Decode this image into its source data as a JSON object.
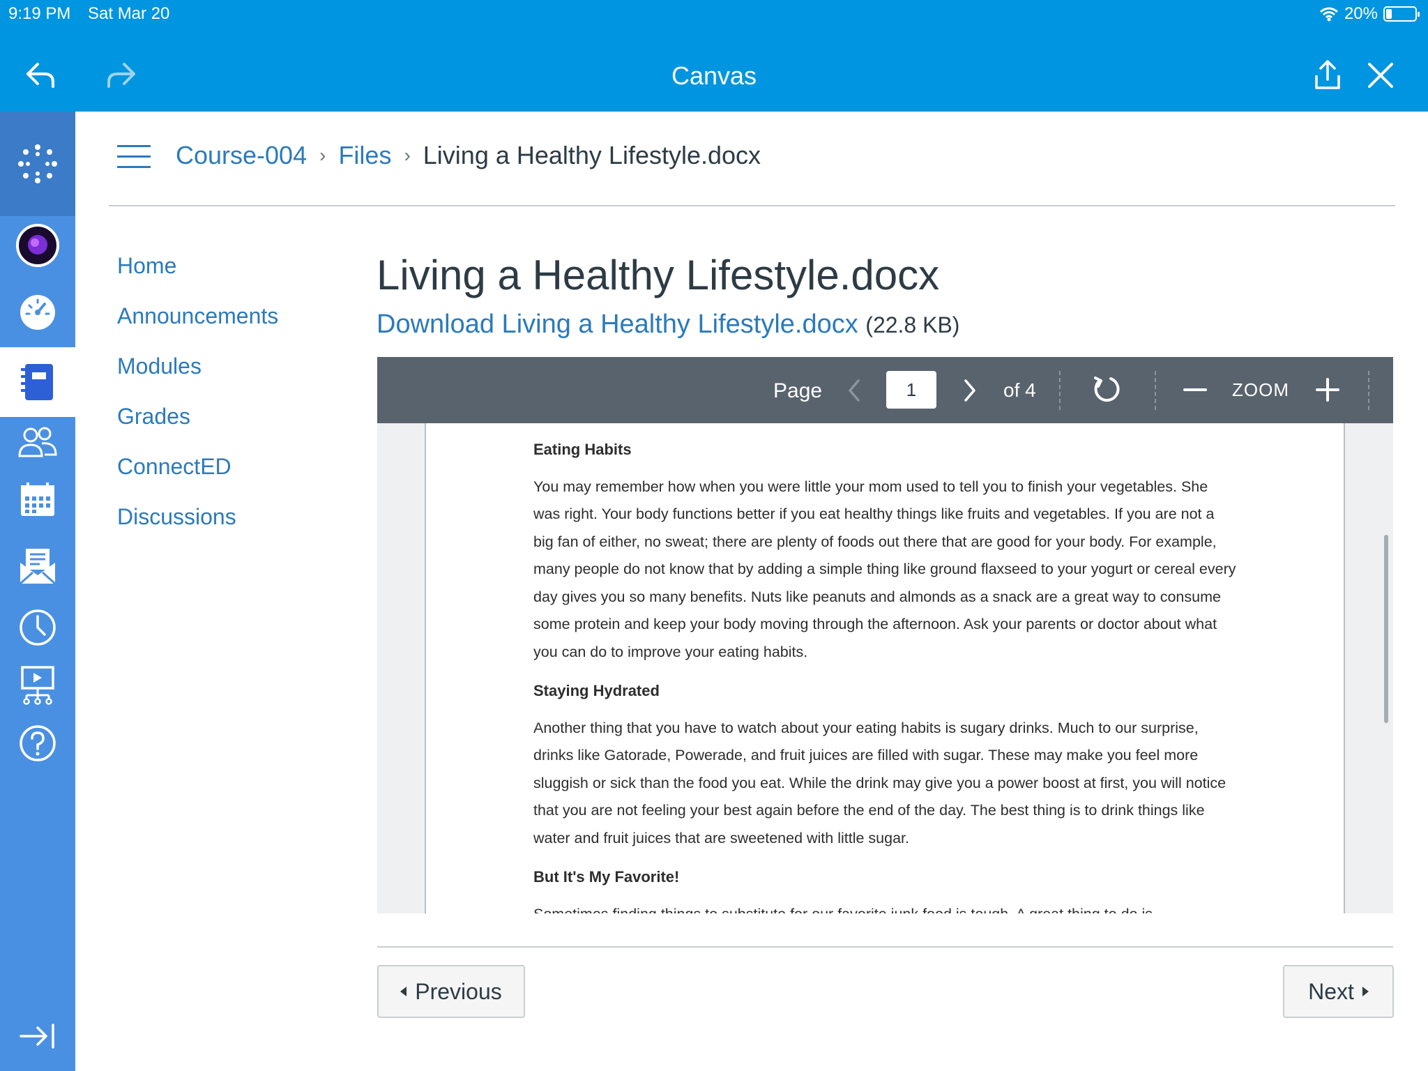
{
  "status_bar": {
    "time": "9:19 PM",
    "date": "Sat Mar 20",
    "battery_percent": "20%",
    "battery_level": 0.2
  },
  "top_nav": {
    "title": "Canvas",
    "icons": [
      "back-arrow-icon",
      "forward-arrow-icon",
      "share-icon",
      "close-icon"
    ]
  },
  "global_nav": {
    "icons": [
      "canvas-logo-icon",
      "account-avatar",
      "dashboard-icon",
      "courses-icon",
      "groups-icon",
      "calendar-icon",
      "inbox-icon",
      "history-icon",
      "studio-icon",
      "help-icon",
      "collapse-nav-icon"
    ]
  },
  "breadcrumb": {
    "course": "Course-004",
    "section": "Files",
    "current": "Living a Healthy Lifestyle.docx"
  },
  "course_nav": {
    "items": [
      "Home",
      "Announcements",
      "Modules",
      "Grades",
      "ConnectED",
      "Discussions"
    ]
  },
  "file": {
    "title": "Living a Healthy Lifestyle.docx",
    "download_label": "Download Living a Healthy Lifestyle.docx",
    "size": "(22.8 KB)"
  },
  "viewer": {
    "page_label": "Page",
    "page_value": "1",
    "page_total": "of 4",
    "zoom_label": "ZOOM",
    "icons": [
      "chevron-left-icon",
      "chevron-right-icon",
      "rotate-icon",
      "zoom-out-icon",
      "zoom-in-icon"
    ]
  },
  "document": {
    "sections": [
      {
        "heading": "Eating Habits",
        "body": "You may remember how when you were little your mom used to tell you to finish your vegetables. She was right. Your body functions better if you eat healthy things like fruits and vegetables. If you are not a big fan of either, no sweat; there are plenty of foods out there that are good for your body. For example, many people do not know that by adding a simple thing like ground flaxseed to your yogurt or cereal every day gives you so many benefits. Nuts like peanuts and almonds as a snack are a great way to consume some protein and keep your body moving through the afternoon. Ask your parents or doctor about what you can do to improve your eating habits."
      },
      {
        "heading": "Staying Hydrated",
        "body": "Another thing that you have to watch about your eating habits is sugary drinks. Much to our surprise, drinks like Gatorade, Powerade, and fruit juices are filled with sugar. These may make you feel more sluggish or sick than the food you eat. While the drink may give you a power boost at first, you will notice that you are not feeling your best again before the end of the day. The best thing is to drink things like water and fruit juices that are sweetened with little sugar."
      },
      {
        "heading": "But It's My Favorite!",
        "body": "Sometimes finding things to substitute for our favorite junk food is tough. A great thing to do is"
      }
    ]
  },
  "pager": {
    "previous": "Previous",
    "next": "Next"
  },
  "colors": {
    "canvas_blue": "#0095e0",
    "nav_blue": "#4a90e2",
    "link_blue": "#2b7abc",
    "toolbar_gray": "#59636d"
  }
}
